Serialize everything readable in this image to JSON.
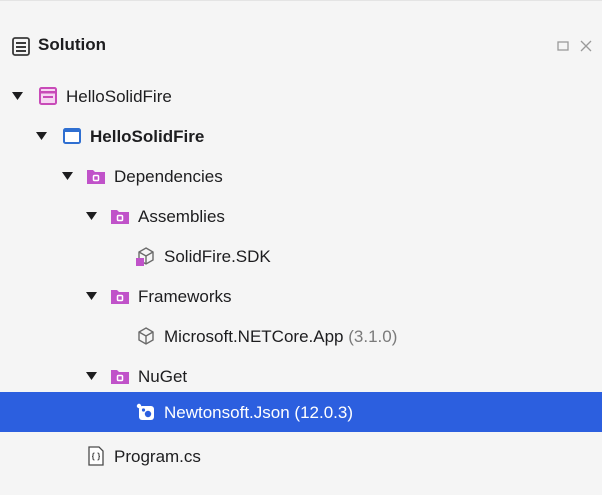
{
  "panel": {
    "title": "Solution",
    "buttons": [
      "maximize-icon",
      "close-icon"
    ]
  },
  "tree": {
    "items": [
      {
        "label": "HelloSolidFire",
        "icon": "solution-icon",
        "level": 0,
        "expanded": true,
        "bold": false
      },
      {
        "label": "HelloSolidFire",
        "icon": "project-icon",
        "level": 1,
        "expanded": true,
        "bold": true
      },
      {
        "label": "Dependencies",
        "icon": "folder-icon",
        "level": 2,
        "expanded": true,
        "bold": false
      },
      {
        "label": "Assemblies",
        "icon": "folder-icon",
        "level": 3,
        "expanded": true,
        "bold": false
      },
      {
        "label": "SolidFire.SDK",
        "icon": "assembly-reference-icon",
        "level": 4,
        "expanded": null,
        "bold": false
      },
      {
        "label": "Frameworks",
        "icon": "folder-icon",
        "level": 3,
        "expanded": true,
        "bold": false
      },
      {
        "label": "Microsoft.NETCore.App",
        "version": "(3.1.0)",
        "icon": "framework-reference-icon",
        "level": 4,
        "expanded": null,
        "bold": false
      },
      {
        "label": "NuGet",
        "icon": "folder-icon",
        "level": 3,
        "expanded": true,
        "bold": false
      },
      {
        "label": "Newtonsoft.Json",
        "version": "(12.0.3)",
        "icon": "nuget-package-icon",
        "level": 4,
        "expanded": null,
        "bold": false,
        "selected": true
      },
      {
        "label": "Program.cs",
        "icon": "csharp-file-icon",
        "level": 2,
        "expanded": null,
        "bold": false
      }
    ]
  },
  "colors": {
    "selection": "#2c5fdf",
    "folder": "#c052c9",
    "solution": "#c84ab8",
    "project": "#2f6fd1",
    "background": "#f5f5f5"
  }
}
